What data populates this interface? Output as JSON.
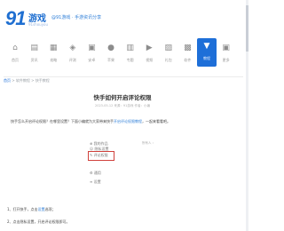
{
  "header": {
    "logo_number": "91",
    "logo_text": "游戏",
    "logo_sub": "91shouyou",
    "tagline": "@91游戏 · 手游资讯分享"
  },
  "nav": {
    "items": [
      {
        "label": "首页",
        "icon": "home-icon",
        "glyph": "⌂"
      },
      {
        "label": "资讯",
        "icon": "news-icon",
        "glyph": "▤"
      },
      {
        "label": "攻略",
        "icon": "guide-icon",
        "glyph": "▦"
      },
      {
        "label": "评测",
        "icon": "review-icon",
        "glyph": "◈"
      },
      {
        "label": "安卓",
        "icon": "android-icon",
        "glyph": "▣"
      },
      {
        "label": "苹果",
        "icon": "apple-icon",
        "glyph": "●"
      },
      {
        "label": "专题",
        "icon": "topic-icon",
        "glyph": "▥"
      },
      {
        "label": "视频",
        "icon": "video-icon",
        "glyph": "▶"
      },
      {
        "label": "礼包",
        "icon": "gift-icon",
        "glyph": "▨"
      },
      {
        "label": "软件",
        "icon": "software-icon",
        "glyph": "▩"
      },
      {
        "label": "教程",
        "icon": "tutorial-icon",
        "glyph": "▼",
        "active": true
      },
      {
        "label": "更多",
        "icon": "more-icon",
        "glyph": "▣"
      }
    ]
  },
  "breadcrumb": {
    "home": "首页",
    "path": " > 软件教程 > 快手教程"
  },
  "article": {
    "title": "快手如何开启评论权限",
    "meta": "2023-05-12  来源：91游戏  作者：小编",
    "intro_a": "快手怎么开启评论权限？在哪里设置？下面小编就为大家带来快手",
    "intro_hl": "开启评论权限教程",
    "intro_b": "，一起来看看吧。",
    "screenshot": {
      "rows": [
        "⊕ 我的作品",
        "☺ 隐私设置",
        "✎ 评论权限",
        "⚙ 通用",
        "≡ 设置"
      ],
      "right_label": "所有人 ›"
    },
    "step1_a": "1、打开快手，点击",
    "step1_hl": "设置",
    "step1_b": "选项；",
    "step2": "2、点击隐私设置，开启评论权限即可。"
  },
  "colors": {
    "accent": "#1e6fd8",
    "highlight_box": "#d0413c",
    "link": "#2f7fd8"
  }
}
